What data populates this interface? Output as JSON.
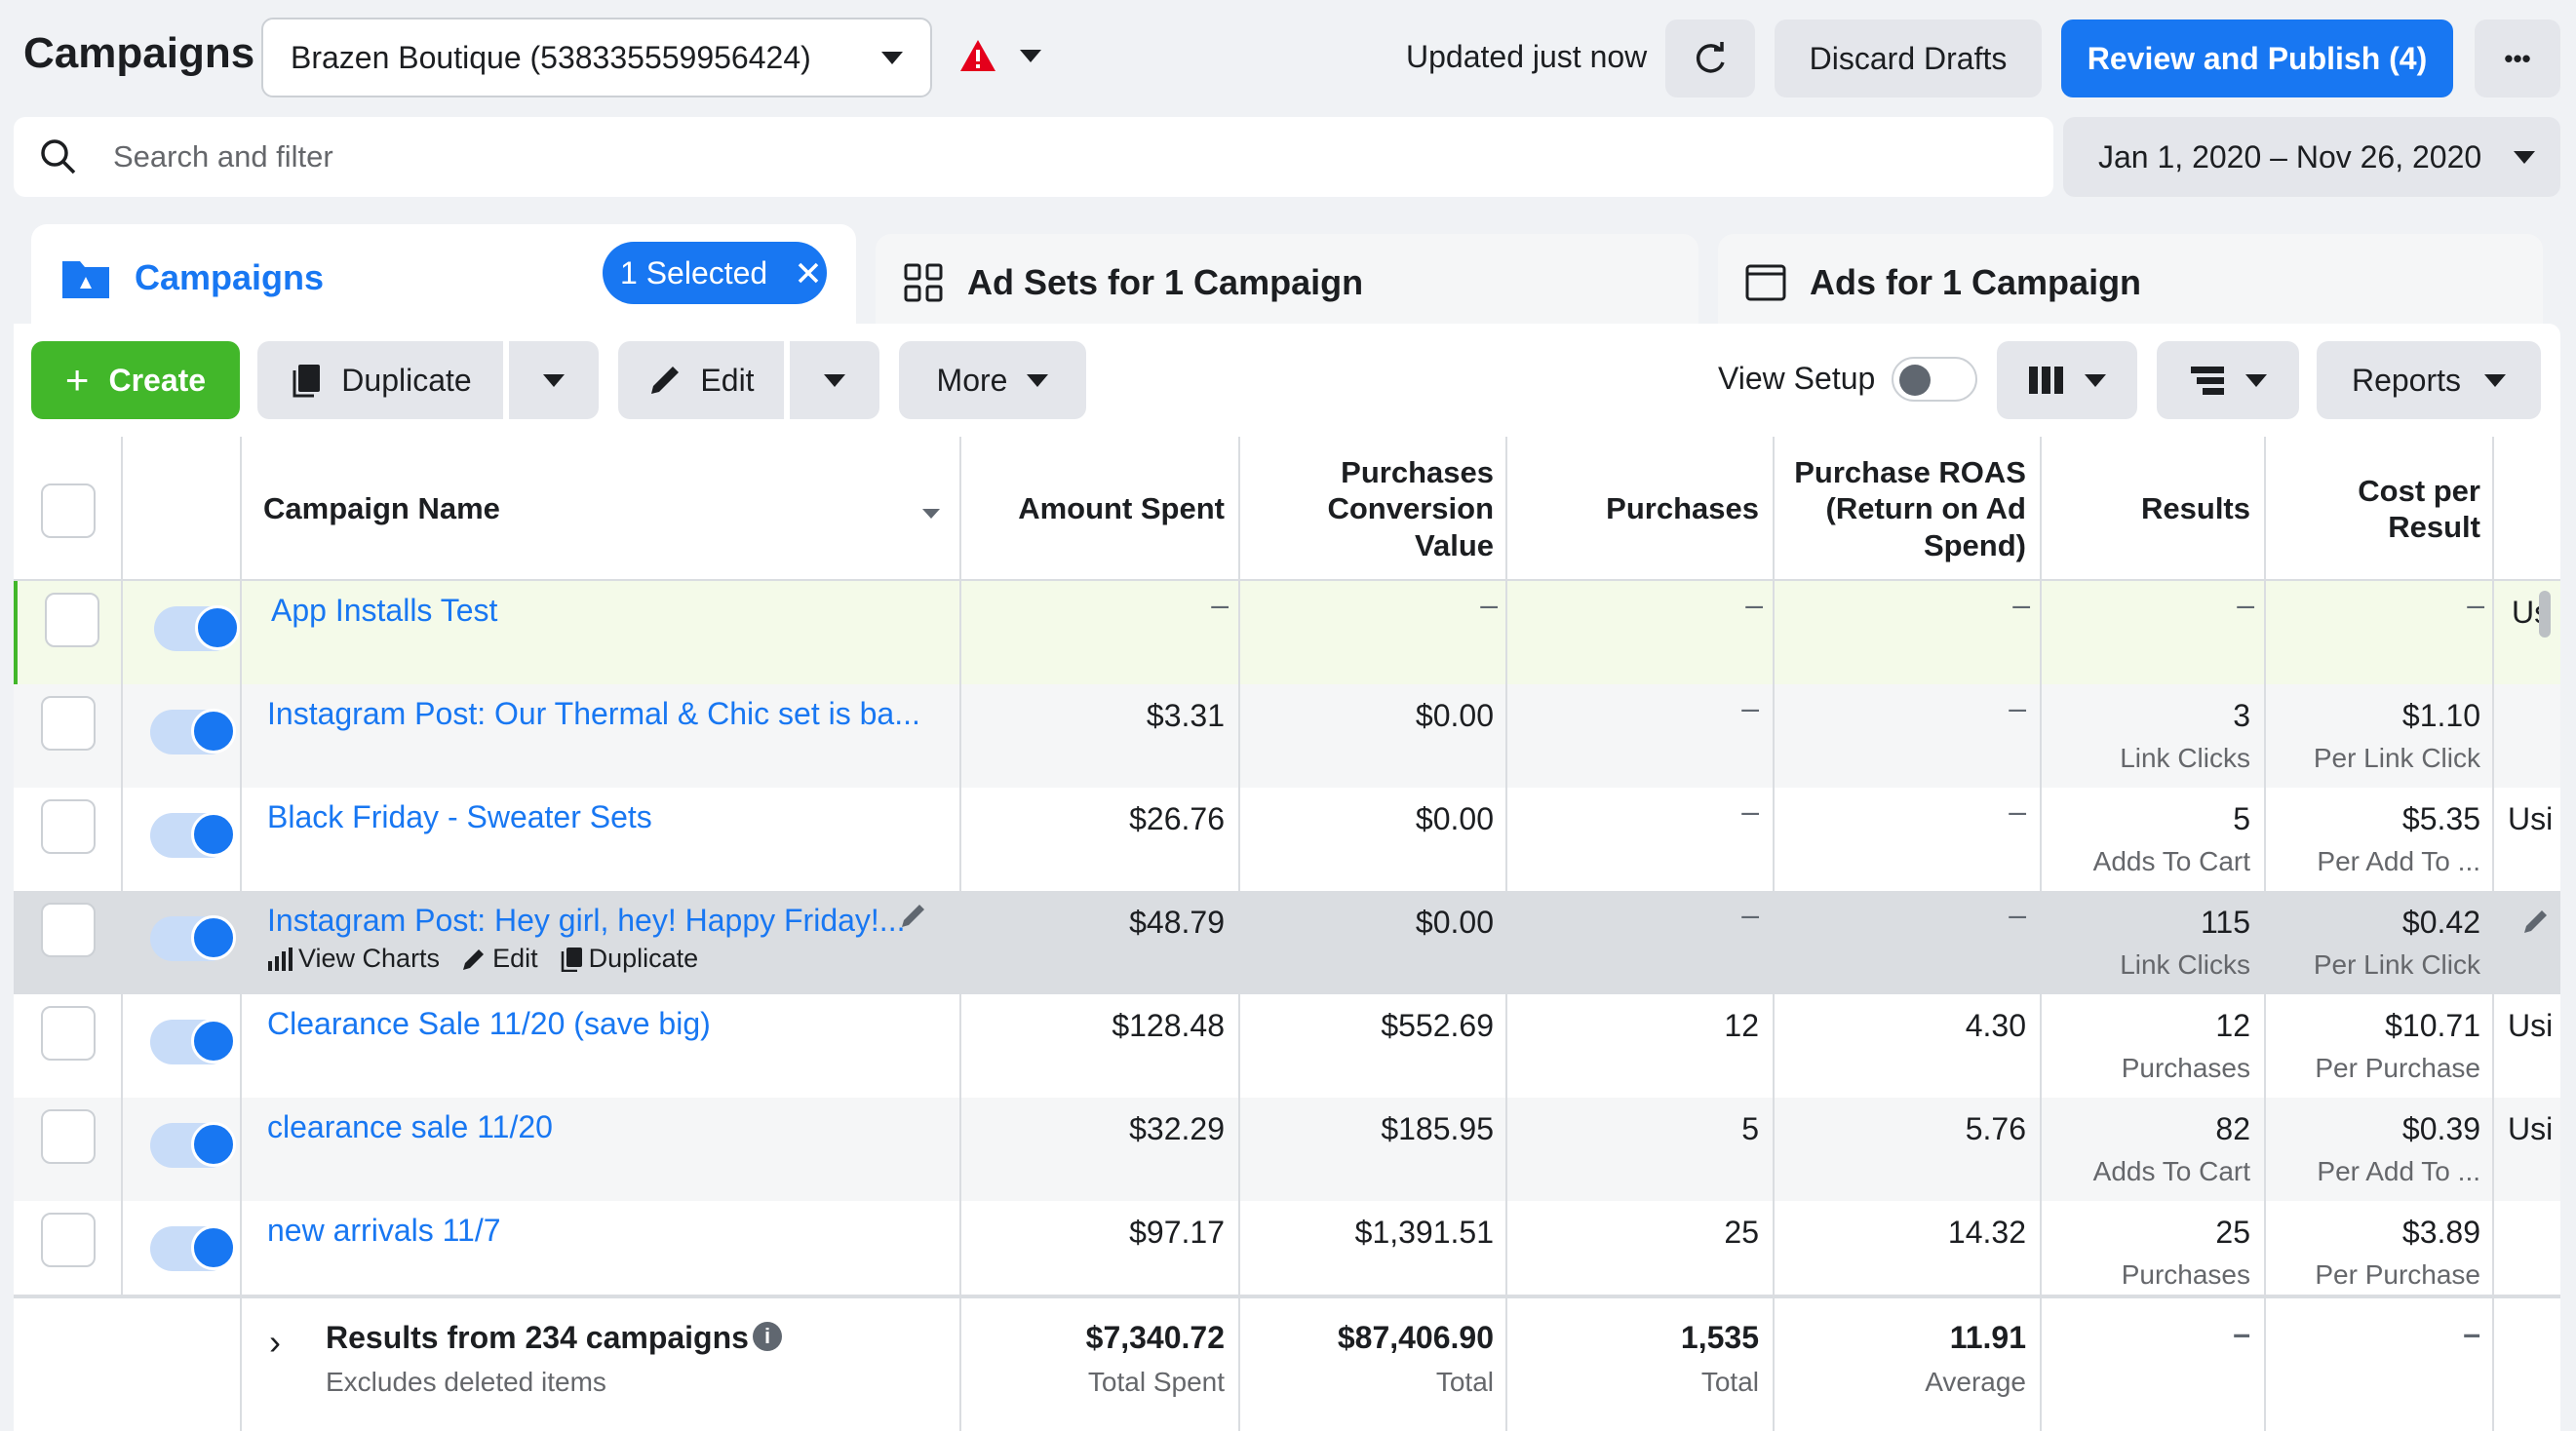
{
  "header": {
    "title": "Campaigns",
    "account": "Brazen Boutique (538335559956424)",
    "updated": "Updated just now",
    "discard_label": "Discard Drafts",
    "publish_label": "Review and Publish (4)",
    "more_label": "•••"
  },
  "search": {
    "placeholder": "Search and filter",
    "date_range": "Jan 1, 2020 – Nov 26, 2020"
  },
  "tabs": {
    "campaigns": "Campaigns",
    "selected": "1 Selected",
    "adsets": "Ad Sets for 1 Campaign",
    "ads": "Ads for 1 Campaign"
  },
  "toolbar": {
    "create": "Create",
    "duplicate": "Duplicate",
    "edit": "Edit",
    "more": "More",
    "view_setup": "View Setup",
    "reports": "Reports"
  },
  "columns": {
    "name": "Campaign Name",
    "amount": "Amount Spent",
    "pcv": "Purchases Conversion Value",
    "purchases": "Purchases",
    "roas": "Purchase ROAS (Return on Ad Spend)",
    "results": "Results",
    "cpr": "Cost per Result"
  },
  "rows": [
    {
      "name": "App Installs Test",
      "amount": "–",
      "pcv": "–",
      "purchases": "–",
      "roas": "–",
      "results": "–",
      "results_sub": "",
      "cpr": "–",
      "cpr_sub": "",
      "extra": "Us"
    },
    {
      "name": "Instagram Post: Our Thermal & Chic set is ba...",
      "amount": "$3.31",
      "pcv": "$0.00",
      "purchases": "–",
      "roas": "–",
      "results": "3",
      "results_sub": "Link Clicks",
      "cpr": "$1.10",
      "cpr_sub": "Per Link Click",
      "extra": ""
    },
    {
      "name": "Black Friday - Sweater Sets",
      "amount": "$26.76",
      "pcv": "$0.00",
      "purchases": "–",
      "roas": "–",
      "results": "5",
      "results_sub": "Adds To Cart",
      "cpr": "$5.35",
      "cpr_sub": "Per Add To ...",
      "extra": "Usi"
    },
    {
      "name": "Instagram Post: Hey girl, hey! Happy Friday!...",
      "amount": "$48.79",
      "pcv": "$0.00",
      "purchases": "–",
      "roas": "–",
      "results": "115",
      "results_sub": "Link Clicks",
      "cpr": "$0.42",
      "cpr_sub": "Per Link Click",
      "extra": ""
    },
    {
      "name": "Clearance Sale 11/20 (save big)",
      "amount": "$128.48",
      "pcv": "$552.69",
      "purchases": "12",
      "roas": "4.30",
      "results": "12",
      "results_sub": "Purchases",
      "cpr": "$10.71",
      "cpr_sub": "Per Purchase",
      "extra": "Usi"
    },
    {
      "name": "clearance sale 11/20",
      "amount": "$32.29",
      "pcv": "$185.95",
      "purchases": "5",
      "roas": "5.76",
      "results": "82",
      "results_sub": "Adds To Cart",
      "cpr": "$0.39",
      "cpr_sub": "Per Add To ...",
      "extra": "Usi"
    },
    {
      "name": "new arrivals 11/7",
      "amount": "$97.17",
      "pcv": "$1,391.51",
      "purchases": "25",
      "roas": "14.32",
      "results": "25",
      "results_sub": "Purchases",
      "cpr": "$3.89",
      "cpr_sub": "Per Purchase",
      "extra": ""
    }
  ],
  "hover_actions": {
    "view_charts": "View Charts",
    "edit": "Edit",
    "duplicate": "Duplicate"
  },
  "totals": {
    "label": "Results from 234 campaigns",
    "sublabel": "Excludes deleted items",
    "amount": "$7,340.72",
    "amount_sub": "Total Spent",
    "pcv": "$87,406.90",
    "pcv_sub": "Total",
    "purchases": "1,535",
    "purchases_sub": "Total",
    "roas": "11.91",
    "roas_sub": "Average",
    "results": "–",
    "cpr": "–"
  },
  "colors": {
    "accent": "#1877f2",
    "create": "#42b72a",
    "warning": "#e4001b"
  }
}
